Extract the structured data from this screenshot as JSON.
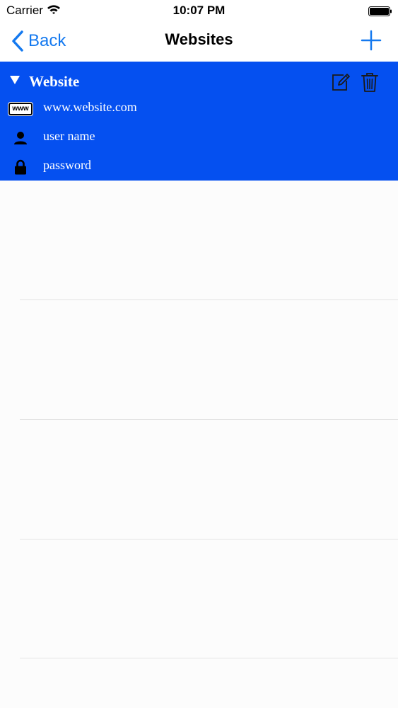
{
  "status_bar": {
    "carrier": "Carrier",
    "time": "10:07 PM",
    "icons": [
      "wifi-icon",
      "battery-icon"
    ]
  },
  "nav": {
    "back_label": "Back",
    "title": "Websites",
    "add_icon": "plus-icon",
    "accent_color": "#1479ef"
  },
  "entry": {
    "title": "Website",
    "background_color": "#0550f0",
    "actions": [
      "edit-icon",
      "trash-icon"
    ],
    "url_badge": "www",
    "url": "www.website.com",
    "username": "user name",
    "password": "password"
  }
}
